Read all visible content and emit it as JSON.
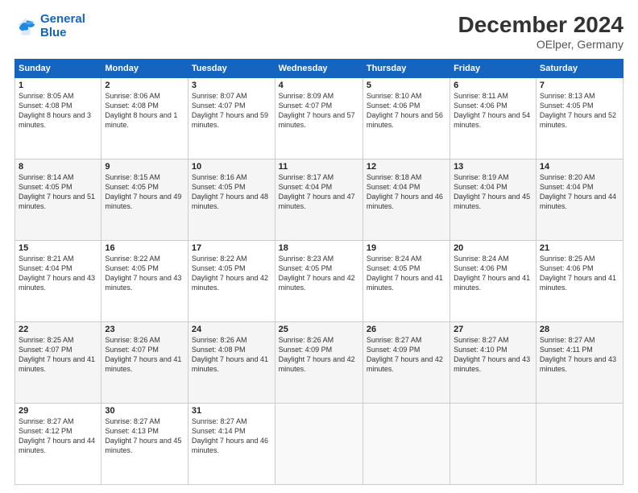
{
  "logo": {
    "line1": "General",
    "line2": "Blue"
  },
  "title": "December 2024",
  "subtitle": "OElper, Germany",
  "headers": [
    "Sunday",
    "Monday",
    "Tuesday",
    "Wednesday",
    "Thursday",
    "Friday",
    "Saturday"
  ],
  "weeks": [
    [
      {
        "day": "1",
        "sunrise": "8:05 AM",
        "sunset": "4:08 PM",
        "daylight": "8 hours and 3 minutes."
      },
      {
        "day": "2",
        "sunrise": "8:06 AM",
        "sunset": "4:08 PM",
        "daylight": "8 hours and 1 minute."
      },
      {
        "day": "3",
        "sunrise": "8:07 AM",
        "sunset": "4:07 PM",
        "daylight": "7 hours and 59 minutes."
      },
      {
        "day": "4",
        "sunrise": "8:09 AM",
        "sunset": "4:07 PM",
        "daylight": "7 hours and 57 minutes."
      },
      {
        "day": "5",
        "sunrise": "8:10 AM",
        "sunset": "4:06 PM",
        "daylight": "7 hours and 56 minutes."
      },
      {
        "day": "6",
        "sunrise": "8:11 AM",
        "sunset": "4:06 PM",
        "daylight": "7 hours and 54 minutes."
      },
      {
        "day": "7",
        "sunrise": "8:13 AM",
        "sunset": "4:05 PM",
        "daylight": "7 hours and 52 minutes."
      }
    ],
    [
      {
        "day": "8",
        "sunrise": "8:14 AM",
        "sunset": "4:05 PM",
        "daylight": "7 hours and 51 minutes."
      },
      {
        "day": "9",
        "sunrise": "8:15 AM",
        "sunset": "4:05 PM",
        "daylight": "7 hours and 49 minutes."
      },
      {
        "day": "10",
        "sunrise": "8:16 AM",
        "sunset": "4:05 PM",
        "daylight": "7 hours and 48 minutes."
      },
      {
        "day": "11",
        "sunrise": "8:17 AM",
        "sunset": "4:04 PM",
        "daylight": "7 hours and 47 minutes."
      },
      {
        "day": "12",
        "sunrise": "8:18 AM",
        "sunset": "4:04 PM",
        "daylight": "7 hours and 46 minutes."
      },
      {
        "day": "13",
        "sunrise": "8:19 AM",
        "sunset": "4:04 PM",
        "daylight": "7 hours and 45 minutes."
      },
      {
        "day": "14",
        "sunrise": "8:20 AM",
        "sunset": "4:04 PM",
        "daylight": "7 hours and 44 minutes."
      }
    ],
    [
      {
        "day": "15",
        "sunrise": "8:21 AM",
        "sunset": "4:04 PM",
        "daylight": "7 hours and 43 minutes."
      },
      {
        "day": "16",
        "sunrise": "8:22 AM",
        "sunset": "4:05 PM",
        "daylight": "7 hours and 43 minutes."
      },
      {
        "day": "17",
        "sunrise": "8:22 AM",
        "sunset": "4:05 PM",
        "daylight": "7 hours and 42 minutes."
      },
      {
        "day": "18",
        "sunrise": "8:23 AM",
        "sunset": "4:05 PM",
        "daylight": "7 hours and 42 minutes."
      },
      {
        "day": "19",
        "sunrise": "8:24 AM",
        "sunset": "4:05 PM",
        "daylight": "7 hours and 41 minutes."
      },
      {
        "day": "20",
        "sunrise": "8:24 AM",
        "sunset": "4:06 PM",
        "daylight": "7 hours and 41 minutes."
      },
      {
        "day": "21",
        "sunrise": "8:25 AM",
        "sunset": "4:06 PM",
        "daylight": "7 hours and 41 minutes."
      }
    ],
    [
      {
        "day": "22",
        "sunrise": "8:25 AM",
        "sunset": "4:07 PM",
        "daylight": "7 hours and 41 minutes."
      },
      {
        "day": "23",
        "sunrise": "8:26 AM",
        "sunset": "4:07 PM",
        "daylight": "7 hours and 41 minutes."
      },
      {
        "day": "24",
        "sunrise": "8:26 AM",
        "sunset": "4:08 PM",
        "daylight": "7 hours and 41 minutes."
      },
      {
        "day": "25",
        "sunrise": "8:26 AM",
        "sunset": "4:09 PM",
        "daylight": "7 hours and 42 minutes."
      },
      {
        "day": "26",
        "sunrise": "8:27 AM",
        "sunset": "4:09 PM",
        "daylight": "7 hours and 42 minutes."
      },
      {
        "day": "27",
        "sunrise": "8:27 AM",
        "sunset": "4:10 PM",
        "daylight": "7 hours and 43 minutes."
      },
      {
        "day": "28",
        "sunrise": "8:27 AM",
        "sunset": "4:11 PM",
        "daylight": "7 hours and 43 minutes."
      }
    ],
    [
      {
        "day": "29",
        "sunrise": "8:27 AM",
        "sunset": "4:12 PM",
        "daylight": "7 hours and 44 minutes."
      },
      {
        "day": "30",
        "sunrise": "8:27 AM",
        "sunset": "4:13 PM",
        "daylight": "7 hours and 45 minutes."
      },
      {
        "day": "31",
        "sunrise": "8:27 AM",
        "sunset": "4:14 PM",
        "daylight": "7 hours and 46 minutes."
      },
      null,
      null,
      null,
      null
    ]
  ],
  "labels": {
    "sunrise": "Sunrise: ",
    "sunset": "Sunset: ",
    "daylight": "Daylight "
  }
}
